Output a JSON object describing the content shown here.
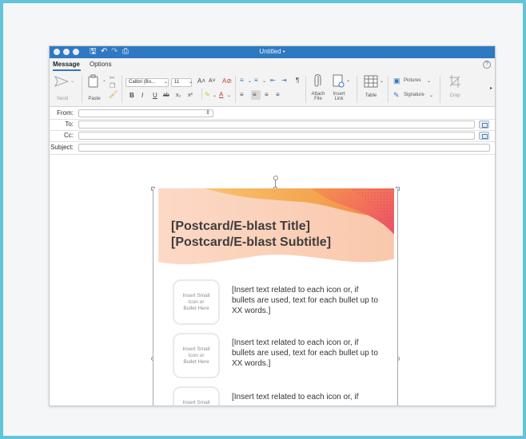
{
  "window": {
    "title": "Untitled •"
  },
  "tabs": {
    "message": "Message",
    "options": "Options"
  },
  "ribbon": {
    "send": "Send",
    "paste": "Paste",
    "font_name": "Calibri (Bo...",
    "font_size": "11",
    "grow_font": "A˄",
    "shrink_font": "A˅",
    "bold": "B",
    "italic": "I",
    "underline": "U",
    "strike": "ab",
    "subscript": "x₂",
    "superscript": "x²",
    "attach_file": "Attach\nFile",
    "insert_link": "Insert\nLink",
    "table": "Table",
    "pictures": "Pictures",
    "signature": "Signature",
    "crop": "Crop",
    "pilcrow": "¶"
  },
  "fields": {
    "from_label": "From:",
    "to_label": "To:",
    "cc_label": "Cc:",
    "subject_label": "Subject:"
  },
  "postcard": {
    "title": "[Postcard/E-blast Title]",
    "subtitle": "[Postcard/E-blast Subtitle]",
    "rows": [
      {
        "icon_text": "Insert Small\nIcon or\nBullet Here",
        "text": "[Insert text related to each icon or, if bullets are used, text for each bullet up to XX words.]"
      },
      {
        "icon_text": "Insert Small\nIcon or\nBullet Here",
        "text": "[Insert text related to each icon or, if bullets are used, text for each bullet up to XX words.]"
      },
      {
        "icon_text": "Insert Small",
        "text": "[Insert text related to each icon or, if"
      }
    ]
  },
  "colors": {
    "frame": "#62c4d8",
    "titlebar": "#2f79c3",
    "wave_peach": "#fbd6c2",
    "wave_orange": "#f5a45a",
    "wave_coral": "#ef5d6a"
  }
}
